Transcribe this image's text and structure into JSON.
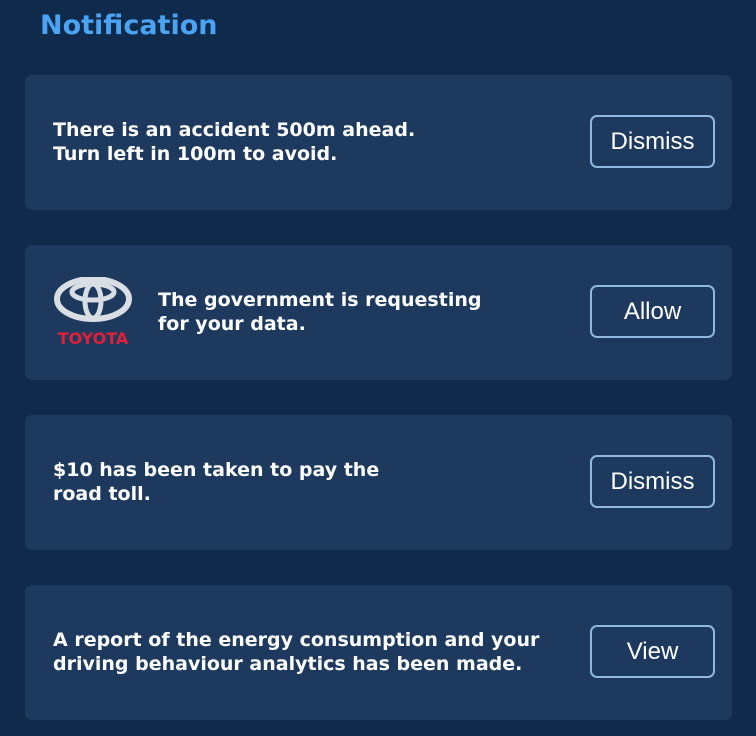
{
  "header": {
    "title": "Notification"
  },
  "notifications": [
    {
      "message": "There is an accident 500m ahead.\nTurn left in 100m to avoid.",
      "action_label": "Dismiss"
    },
    {
      "logo": {
        "icon": "toyota-logo",
        "wordmark": "TOYOTA",
        "wordmark_color": "#e0203a"
      },
      "message": "The government is requesting\nfor your data.",
      "action_label": "Allow"
    },
    {
      "message": "$10 has been taken to pay the\nroad toll.",
      "action_label": "Dismiss"
    },
    {
      "message": "A report of the energy consumption and your\ndriving behaviour analytics has been made.",
      "action_label": "View"
    }
  ],
  "colors": {
    "background": "#0f2a4b",
    "card": "#1d3a5e",
    "title": "#4aa3f3",
    "button_border": "#8fb8de"
  }
}
